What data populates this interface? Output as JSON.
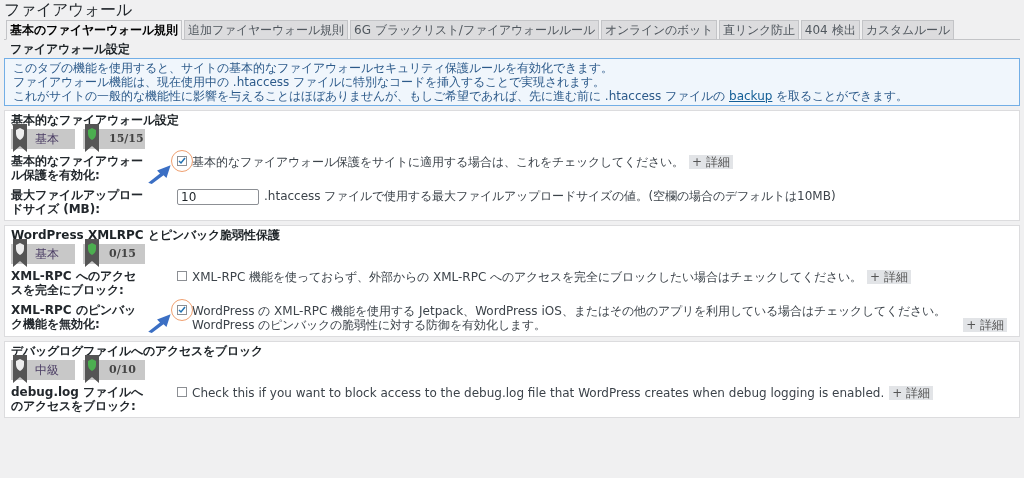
{
  "page_title": "ファイアウォール",
  "tabs": [
    {
      "label": "基本のファイヤーウォール規則",
      "selected": true
    },
    {
      "label": "追加ファイヤーウォール規則",
      "selected": false
    },
    {
      "label": "6G ブラックリスト/ファイアウォールルール",
      "selected": false
    },
    {
      "label": "オンラインのボット",
      "selected": false
    },
    {
      "label": "直リンク防止",
      "selected": false
    },
    {
      "label": "404 検出",
      "selected": false
    },
    {
      "label": "カスタムルール",
      "selected": false
    }
  ],
  "section_heading": "ファイアウォール設定",
  "info": {
    "lines": [
      {
        "text": "このタブの機能を使用すると、サイトの基本的なファイアウォールセキュリティ保護ルールを有効化できます。"
      },
      {
        "text": "ファイアウォール機能は、現在使用中の .htaccess ファイルに特別なコードを挿入することで実現されます。"
      },
      {
        "text": "これがサイトの一般的な機能性に影響を与えることはほぼありませんが、もしご希望であれば、先に進む前に .htaccess ファイルの ",
        "link": "backup",
        "after": " を取ることができます。"
      }
    ]
  },
  "sections": [
    {
      "title": "基本的なファイアウォール設定",
      "level_badge": "基本",
      "score": "15/15",
      "rows": [
        {
          "kind": "checkbox",
          "label": "基本的なファイアウォール保護を有効化:",
          "checked": true,
          "highlighted": true,
          "description": "基本的なファイアウォール保護をサイトに適用する場合は、これをチェックしてください。",
          "detail_button": "+ 詳細"
        },
        {
          "kind": "number",
          "label": "最大ファイルアップロードサイズ (MB):",
          "value": "10",
          "description": ".htaccess ファイルで使用する最大ファイルアップロードサイズの値。(空欄の場合のデフォルトは10MB)"
        }
      ]
    },
    {
      "title": "WordPress XMLRPC とピンバック脆弱性保護",
      "level_badge": "基本",
      "score": "0/15",
      "rows": [
        {
          "kind": "checkbox",
          "label": "XML-RPC へのアクセスを完全にブロック:",
          "checked": false,
          "highlighted": false,
          "description": "XML-RPC 機能を使っておらず、外部からの XML-RPC へのアクセスを完全にブロックしたい場合はチェックしてください。",
          "detail_button": "+ 詳細"
        },
        {
          "kind": "checkbox",
          "label": "XML-RPC のピンバック機能を無効化:",
          "checked": true,
          "highlighted": true,
          "description": "WordPress の XML-RPC 機能を使用する Jetpack、WordPress iOS、またはその他のアプリを利用している場合はチェックしてください。WordPress のピンバックの脆弱性に対する防御を有効化します。",
          "detail_button": "+ 詳細"
        }
      ]
    },
    {
      "title": "デバッグログファイルへのアクセスをブロック",
      "level_badge": "中級",
      "score": "0/10",
      "rows": [
        {
          "kind": "checkbox",
          "label": "debug.log ファイルへのアクセスをブロック:",
          "checked": false,
          "highlighted": false,
          "description": "Check this if you want to block access to the debug.log file that WordPress creates when debug logging is enabled.",
          "detail_button": "+ 詳細"
        }
      ]
    }
  ]
}
